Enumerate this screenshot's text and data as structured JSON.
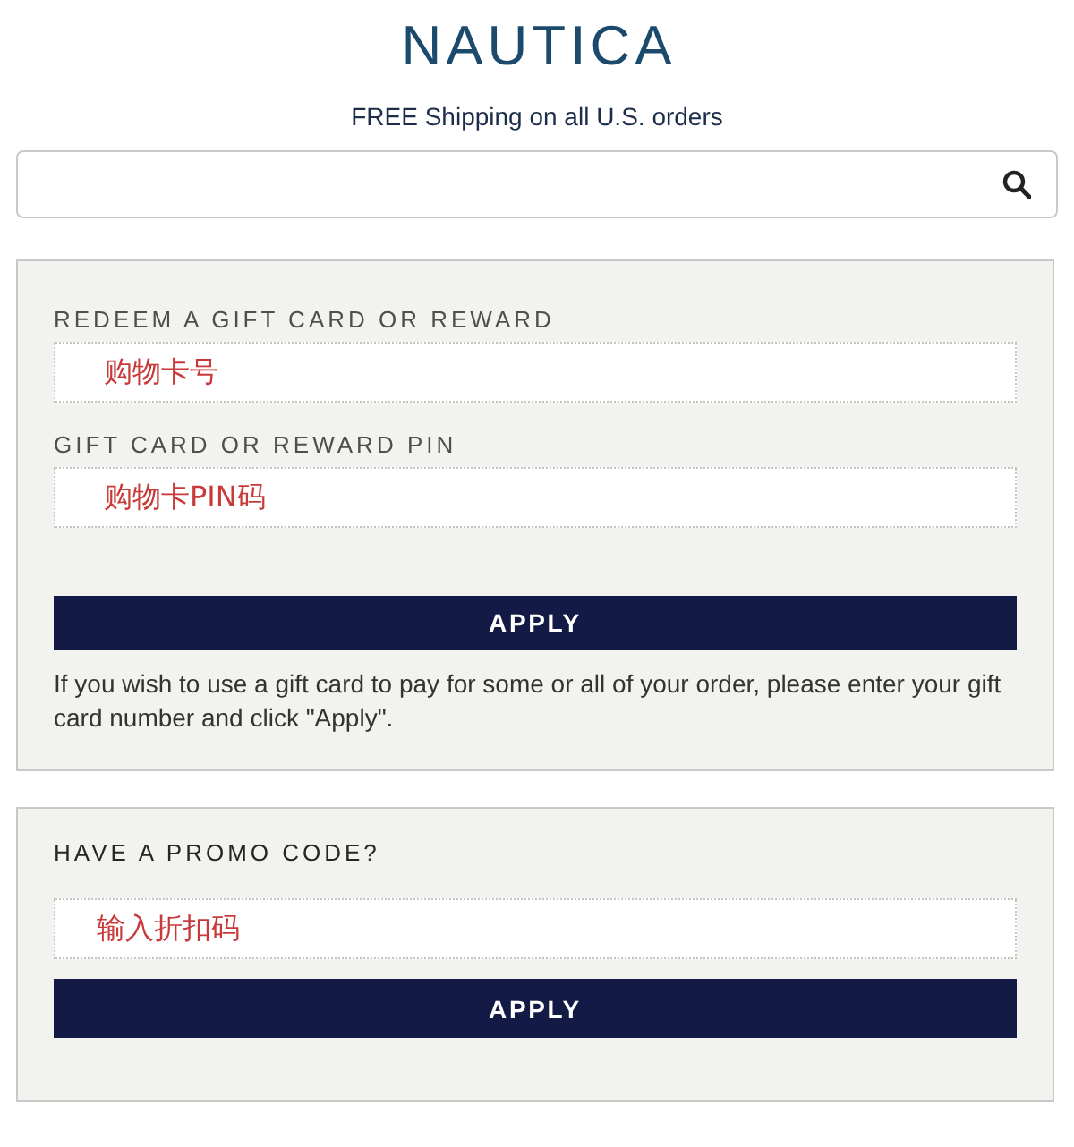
{
  "header": {
    "logo": "NAUTICA",
    "tagline": "FREE Shipping on all U.S. orders"
  },
  "sections": [
    {
      "fields": [
        {
          "label": "REDEEM A GIFT CARD OR REWARD",
          "value": "购物卡号"
        },
        {
          "label": "GIFT CARD OR REWARD PIN",
          "value": "购物卡PIN码"
        }
      ],
      "button": "APPLY",
      "note": "If you wish to use a gift card to pay for some or all of your order, please enter your gift card number and click \"Apply\"."
    },
    {
      "fields": [
        {
          "label": "HAVE A PROMO CODE?",
          "value": "输入折扣码"
        }
      ],
      "button": "APPLY"
    }
  ]
}
